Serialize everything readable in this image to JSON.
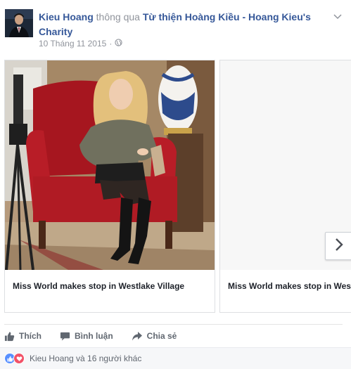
{
  "post": {
    "author": "Kieu Hoang",
    "via_text": "thông qua",
    "page_name": "Từ thiện Hoàng Kiều - Hoang Kieu's Charity",
    "date": "10 Tháng 11 2015",
    "audience_icon": "globe-icon",
    "options_icon": "chevron-down-icon"
  },
  "carousel": {
    "cards": [
      {
        "caption": "Miss World makes stop in Westlake Village"
      },
      {
        "caption": "Miss World makes stop in Westlake Village"
      }
    ],
    "next_icon": "chevron-right-icon"
  },
  "actions": {
    "like_label": "Thích",
    "comment_label": "Bình luận",
    "share_label": "Chia sẻ"
  },
  "reactions": {
    "summary": "Kieu Hoang và 16 người khác",
    "icons": [
      "like-reaction-icon",
      "love-reaction-icon"
    ],
    "colors": {
      "like": "#5890ff",
      "love": "#f25268"
    }
  },
  "colors": {
    "link": "#365899",
    "muted": "#90949c",
    "action_text": "#606770"
  }
}
